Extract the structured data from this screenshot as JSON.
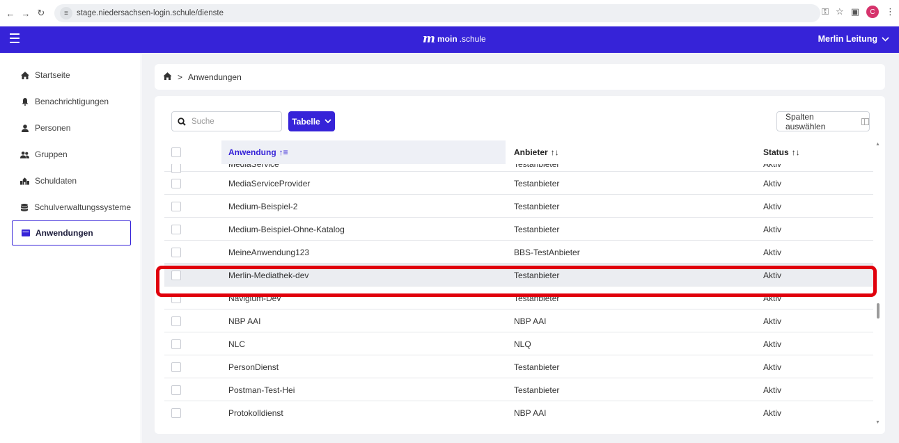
{
  "browser": {
    "url": "stage.niedersachsen-login.schule/dienste",
    "profile_initial": "C"
  },
  "header": {
    "brand_prefix": "moin",
    "brand_suffix": ".schule",
    "user_name": "Merlin Leitung"
  },
  "sidebar": {
    "items": [
      {
        "label": "Startseite",
        "icon": "home-icon"
      },
      {
        "label": "Benachrichtigungen",
        "icon": "bell-icon"
      },
      {
        "label": "Personen",
        "icon": "person-icon"
      },
      {
        "label": "Gruppen",
        "icon": "group-icon"
      },
      {
        "label": "Schuldaten",
        "icon": "school-icon"
      },
      {
        "label": "Schulverwaltungssysteme",
        "icon": "database-icon"
      },
      {
        "label": "Anwendungen",
        "icon": "apps-icon",
        "active": true
      }
    ]
  },
  "breadcrumb": {
    "current": "Anwendungen"
  },
  "toolbar": {
    "search_placeholder": "Suche",
    "view_button": "Tabelle",
    "columns_button": "Spalten auswählen"
  },
  "table": {
    "columns": [
      "Anwendung",
      "Anbieter",
      "Status"
    ],
    "rows": [
      {
        "anwendung": "MediaService",
        "anbieter": "Testanbieter",
        "status": "Aktiv"
      },
      {
        "anwendung": "MediaServiceProvider",
        "anbieter": "Testanbieter",
        "status": "Aktiv"
      },
      {
        "anwendung": "Medium-Beispiel-2",
        "anbieter": "Testanbieter",
        "status": "Aktiv"
      },
      {
        "anwendung": "Medium-Beispiel-Ohne-Katalog",
        "anbieter": "Testanbieter",
        "status": "Aktiv"
      },
      {
        "anwendung": "MeineAnwendung123",
        "anbieter": "BBS-TestAnbieter",
        "status": "Aktiv"
      },
      {
        "anwendung": "Merlin-Mediathek-dev",
        "anbieter": "Testanbieter",
        "status": "Aktiv",
        "highlighted": true
      },
      {
        "anwendung": "Navigium-Dev",
        "anbieter": "Testanbieter",
        "status": "Aktiv"
      },
      {
        "anwendung": "NBP AAI",
        "anbieter": "NBP AAI",
        "status": "Aktiv"
      },
      {
        "anwendung": "NLC",
        "anbieter": "NLQ",
        "status": "Aktiv"
      },
      {
        "anwendung": "PersonDienst",
        "anbieter": "Testanbieter",
        "status": "Aktiv"
      },
      {
        "anwendung": "Postman-Test-Hei",
        "anbieter": "Testanbieter",
        "status": "Aktiv"
      },
      {
        "anwendung": "Protokolldienst",
        "anbieter": "NBP AAI",
        "status": "Aktiv"
      }
    ]
  },
  "colors": {
    "brand": "#3623d8",
    "highlight": "#e0000c"
  }
}
